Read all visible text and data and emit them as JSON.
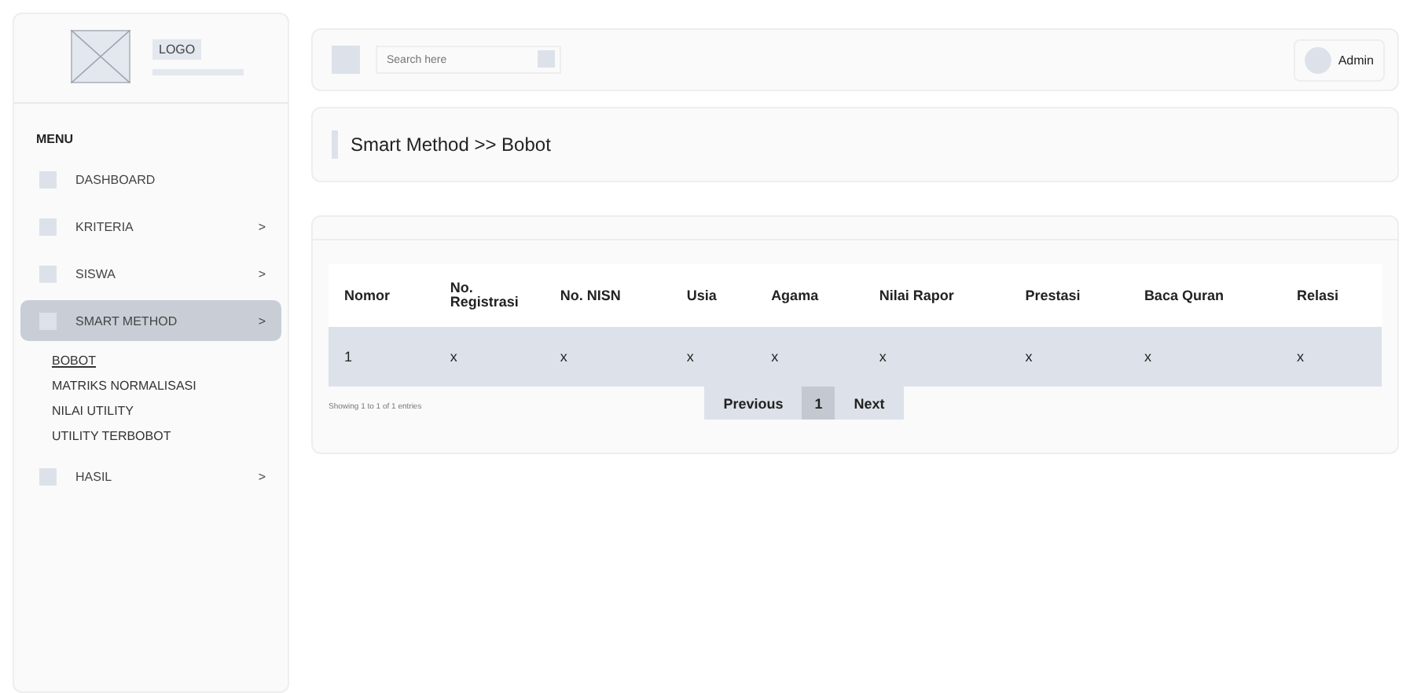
{
  "sidebar": {
    "logo": "LOGO",
    "menu_heading": "MENU",
    "items": [
      {
        "label": "DASHBOARD",
        "selected": false
      },
      {
        "label": "KRITERIA",
        "arrow": ">",
        "selected": false
      },
      {
        "label": "SISWA",
        "arrow": ">",
        "selected": false
      },
      {
        "label": "SMART METHOD",
        "arrow": ">",
        "selected": true,
        "children": [
          {
            "label": "BOBOT",
            "selected": true
          },
          {
            "label": "MATRIKS NORMALISASI",
            "selected": false
          },
          {
            "label": "NILAI UTILITY",
            "selected": false
          },
          {
            "label": "UTILITY TERBOBOT",
            "selected": false
          }
        ]
      },
      {
        "label": "HASIL",
        "arrow": ">",
        "selected": false
      }
    ]
  },
  "topbar": {
    "search": {
      "placeholder": "Search here"
    },
    "user": "Admin"
  },
  "breadcrumb": "Smart Method >> Bobot",
  "table": {
    "columns": [
      "Nomor",
      "No. Registrasi",
      "No. NISN",
      "Usia",
      "Agama",
      "Nilai Rapor",
      "Prestasi",
      "Baca Quran",
      "Relasi"
    ],
    "rows": [
      [
        "1",
        "x",
        "x",
        "x",
        "x",
        "x",
        "x",
        "x",
        "x"
      ]
    ]
  },
  "footer": {
    "info": "Showing 1 to 1 of 1 entries",
    "previous": "Previous",
    "pages": [
      {
        "label": "1",
        "selected": true
      }
    ],
    "next": "Next"
  }
}
